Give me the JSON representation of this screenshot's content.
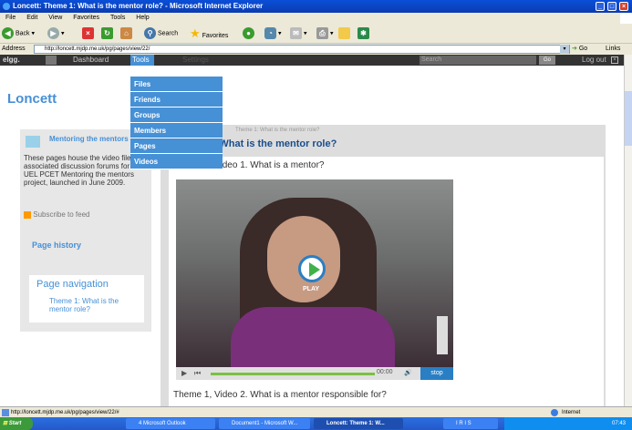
{
  "browser": {
    "title": "Loncett: Theme 1: What is the mentor role? - Microsoft Internet Explorer",
    "menu": [
      "File",
      "Edit",
      "View",
      "Favorites",
      "Tools",
      "Help"
    ],
    "toolbar": {
      "back": "Back",
      "search": "Search",
      "favorites": "Favorites",
      "go": "Go",
      "links": "Links"
    },
    "address_label": "Address",
    "address_value": "http://loncett.mjdp.me.uk/pg/pages/view/22/"
  },
  "elgg": {
    "logo": "elgg.",
    "nav": {
      "dashboard": "Dashboard",
      "tools": "Tools",
      "settings": "Settings"
    },
    "search_placeholder": "Search",
    "go": "Go",
    "logout": "Log out"
  },
  "tools_menu": [
    "Files",
    "Friends",
    "Groups",
    "Members",
    "Pages",
    "Videos"
  ],
  "site": {
    "title": "Loncett"
  },
  "sidebar": {
    "group_title": "Mentoring the mentors",
    "description": "These pages house the video files and associated discussion forums for the UEL PCET Mentoring the mentors project, launched in June 2009.",
    "subscribe": "Subscribe to feed",
    "page_history": "Page history",
    "page_navigation": "Page navigation",
    "nav_item": "Theme 1: What is the mentor role?"
  },
  "content": {
    "breadcrumb": "Theme 1: What is the mentor role?",
    "heading": "Theme 1: What is the mentor role?",
    "video1_title": "Theme 1, Video 1. What is a mentor?",
    "video2_title": "Theme 1, Video 2. What is a mentor responsible for?",
    "play_label": "PLAY",
    "time": "00:00",
    "stop": "stop"
  },
  "status": {
    "url": "http://loncett.mjdp.me.uk/pg/pages/view/22/#",
    "zone": "Internet"
  },
  "taskbar": {
    "start": "Start",
    "tasks": [
      "4 Microsoft Outlook",
      "Document1 - Microsoft W...",
      "Loncett: Theme 1: W...",
      "I R I S"
    ],
    "clock": "07:43"
  },
  "colors": {
    "accent": "#4690d6",
    "elgg_bar": "#333333",
    "xp_blue": "#0a4fd8"
  }
}
